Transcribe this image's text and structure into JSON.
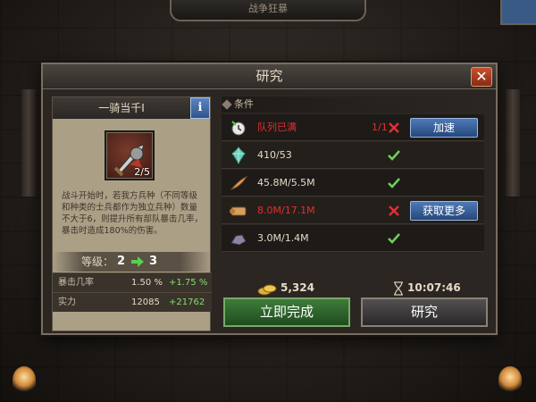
{
  "window": {
    "title": "研究",
    "top_banner": "战争狂暴"
  },
  "skill": {
    "name": "一骑当千I",
    "count": "2/5",
    "description": "战斗开始时，若我方兵种（不同等级和种类的士兵都作为独立兵种）数量不大于6，则提升所有部队暴击几率，暴击时造成180%的伤害。",
    "level_label": "等级：",
    "level_from": "2",
    "level_to": "3",
    "stats": [
      {
        "name": "暴击几率",
        "value": "1.50 %",
        "bonus": "+1.75 %"
      },
      {
        "name": "实力",
        "value": "12085",
        "bonus": "+21762"
      }
    ]
  },
  "conditions": {
    "header": "条件",
    "rows": [
      {
        "icon": "queue-timer-icon",
        "text": "队列已满",
        "count": "1/1",
        "met": false,
        "button": "加速"
      },
      {
        "icon": "crystal-icon",
        "text": "410/53",
        "met": true
      },
      {
        "icon": "feather-wood-icon",
        "text": "45.8M/5.5M",
        "met": true
      },
      {
        "icon": "scroll-icon",
        "text": "8.0M/17.1M",
        "met": false,
        "button": "获取更多"
      },
      {
        "icon": "ore-icon",
        "text": "3.0M/1.4M",
        "met": true
      }
    ]
  },
  "cost": {
    "gold": "5,324",
    "time": "10:07:46"
  },
  "buttons": {
    "instant": "立即完成",
    "research": "研究"
  },
  "colors": {
    "accent_blue": "#3a6aa8",
    "accent_green": "#3e7c3a",
    "warn_red": "#e03030",
    "ok_green": "#6ed05a"
  }
}
